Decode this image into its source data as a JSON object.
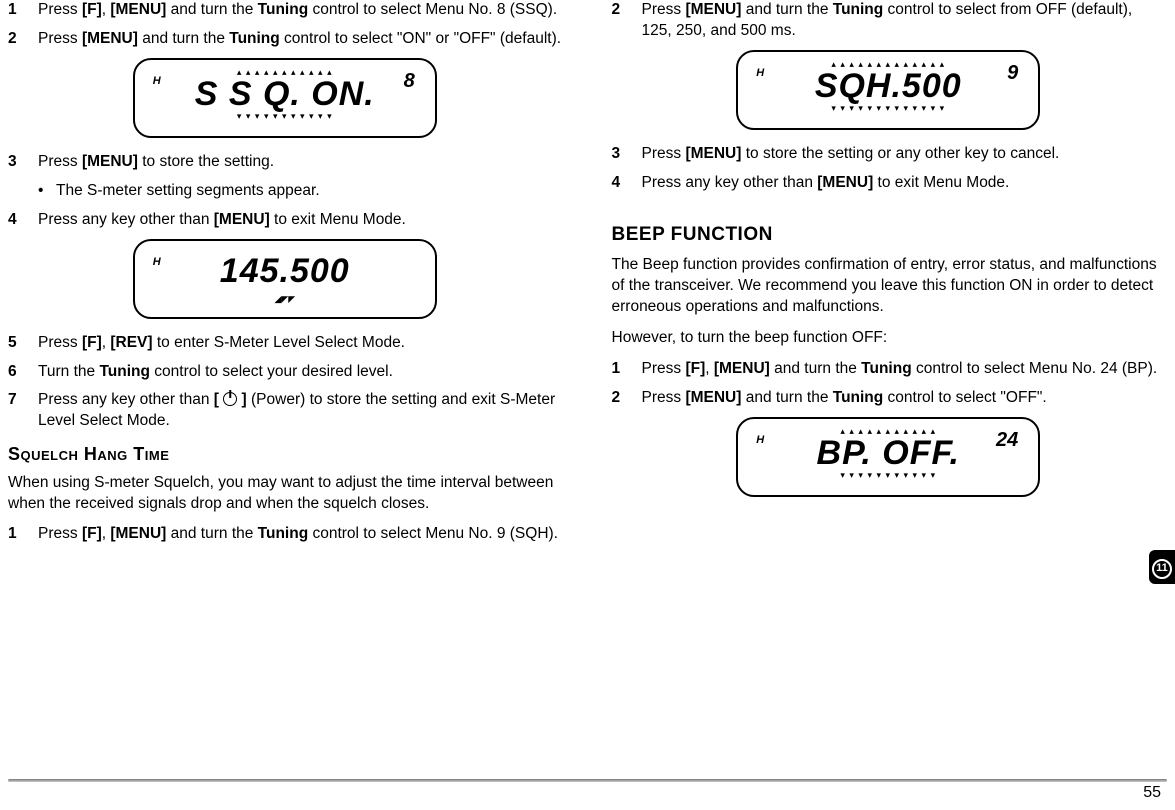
{
  "page_number": "55",
  "side_tab": "11",
  "left": {
    "step1": {
      "num": "1",
      "text_a": "Press ",
      "f": "[F]",
      "comma": ", ",
      "menu": "[MENU]",
      "text_b": " and turn the ",
      "tuning": "Tuning",
      "text_c": " control to select Menu No. 8 (SSQ)."
    },
    "step2": {
      "num": "2",
      "text_a": "Press ",
      "menu": "[MENU]",
      "text_b": " and turn the ",
      "tuning": "Tuning",
      "text_c": " control to select \"ON\" or \"OFF\" (default)."
    },
    "lcd1": {
      "h": "H",
      "main": "S S Q.  ON.",
      "menu": "8"
    },
    "step3": {
      "num": "3",
      "text_a": "Press ",
      "menu": "[MENU]",
      "text_b": " to store the setting."
    },
    "step3sub": "The S-meter setting segments appear.",
    "step4": {
      "num": "4",
      "text_a": "Press any key other than ",
      "menu": "[MENU]",
      "text_b": " to exit Menu Mode."
    },
    "lcd2": {
      "h": "H",
      "main": " 145.500",
      "smeter": "◢◤◤"
    },
    "step5": {
      "num": "5",
      "text_a": "Press ",
      "f": "[F]",
      "comma": ", ",
      "rev": "[REV]",
      "text_b": " to enter S-Meter Level Select Mode."
    },
    "step6": {
      "num": "6",
      "text_a": "Turn the ",
      "tuning": "Tuning",
      "text_b": " control to select your desired level."
    },
    "step7": {
      "num": "7",
      "text_a": "Press any key other than ",
      "pwr_open": "[ ",
      "pwr_close": " ]",
      "text_b": " (Power) to store the setting and exit S-Meter Level Select Mode."
    },
    "heading_sht": "Squelch Hang Time",
    "sht_para": "When using S-meter Squelch, you may want to adjust the time interval between when the received signals drop and when the squelch closes.",
    "sht_step1": {
      "num": "1",
      "text_a": "Press ",
      "f": "[F]",
      "comma": ", ",
      "menu": "[MENU]",
      "text_b": " and turn the ",
      "tuning": "Tuning",
      "text_c": " control to select Menu No. 9 (SQH)."
    }
  },
  "right": {
    "step2": {
      "num": "2",
      "text_a": "Press ",
      "menu": "[MENU]",
      "text_b": " and turn the ",
      "tuning": "Tuning",
      "text_c": " control to select from OFF (default), 125, 250, and 500 ms."
    },
    "lcd1": {
      "h": "H",
      "main": "SQH.500",
      "menu": "9"
    },
    "step3": {
      "num": "3",
      "text_a": "Press ",
      "menu": "[MENU]",
      "text_b": " to store the setting or any other key to cancel."
    },
    "step4": {
      "num": "4",
      "text_a": "Press any key other than ",
      "menu": "[MENU]",
      "text_b": " to exit Menu Mode."
    },
    "heading_beep": "BEEP FUNCTION",
    "beep_para1": "The Beep function provides confirmation of entry, error status, and malfunctions of the transceiver.  We recommend you leave this function ON in order to detect erroneous operations and malfunctions.",
    "beep_para2": "However, to turn the beep function OFF:",
    "beep_step1": {
      "num": "1",
      "text_a": "Press ",
      "f": "[F]",
      "comma": ", ",
      "menu": "[MENU]",
      "text_b": " and turn the ",
      "tuning": "Tuning",
      "text_c": " control to select Menu No. 24 (BP)."
    },
    "beep_step2": {
      "num": "2",
      "text_a": "Press ",
      "menu": "[MENU]",
      "text_b": " and turn the ",
      "tuning": "Tuning",
      "text_c": " control to select \"OFF\"."
    },
    "lcd2": {
      "h": "H",
      "main": "BP.  OFF.",
      "menu": "24"
    }
  }
}
